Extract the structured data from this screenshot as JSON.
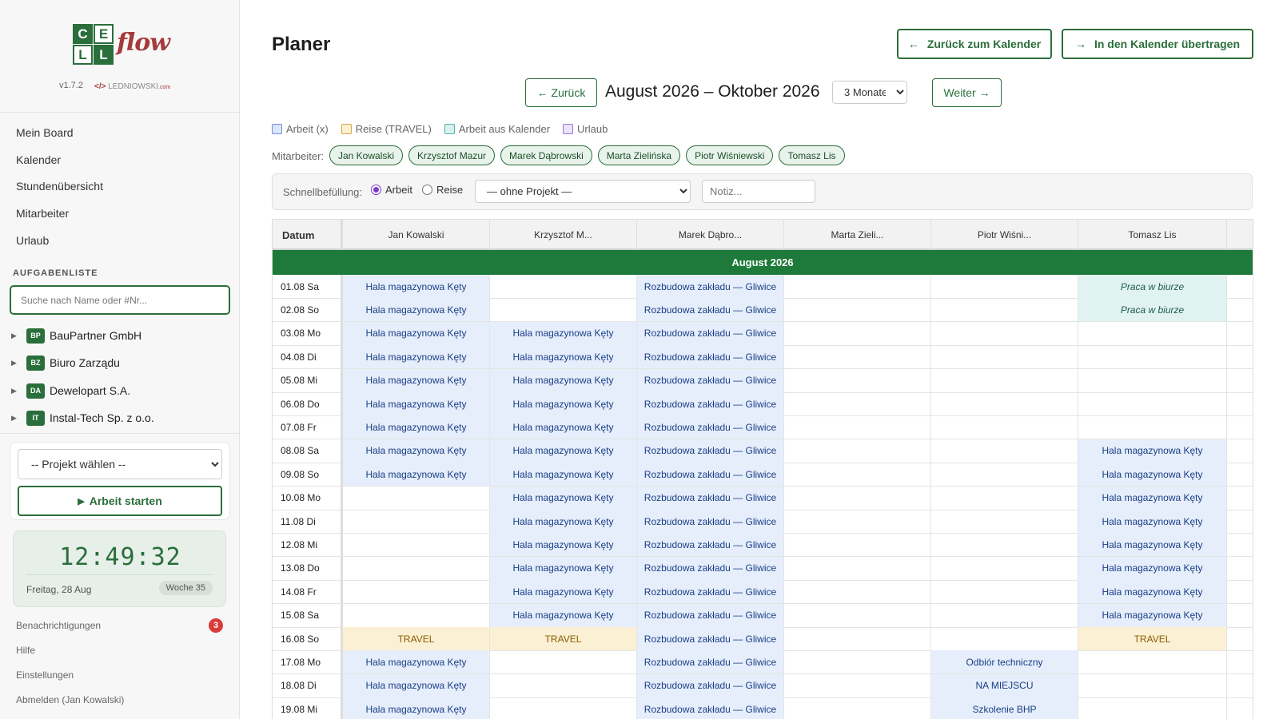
{
  "app": {
    "logo_letters": [
      "C",
      "E",
      "L",
      "L"
    ],
    "logo_word": "flow",
    "version": "v1.7.2",
    "brand_prefix": "</>",
    "brand_name": "LEDNIOWSKI",
    "brand_suffix": ".com"
  },
  "sidebar": {
    "nav": [
      "Mein Board",
      "Kalender",
      "Stundenübersicht",
      "Mitarbeiter",
      "Urlaub"
    ],
    "section_title": "AUFGABENLISTE",
    "search_placeholder": "Suche nach Name oder #Nr...",
    "tree": [
      {
        "abbr": "BP",
        "name": "BauPartner GmbH"
      },
      {
        "abbr": "BZ",
        "name": "Biuro Zarządu"
      },
      {
        "abbr": "DA",
        "name": "Dewelopart S.A."
      },
      {
        "abbr": "IT",
        "name": "Instal-Tech Sp. z o.o."
      }
    ],
    "project_select": "-- Projekt wählen --",
    "start_button": "Arbeit starten",
    "clock": {
      "time": "12:49:32",
      "date": "Freitag, 28 Aug",
      "week": "Woche 35"
    },
    "footer": {
      "notifications": "Benachrichtigungen",
      "notifications_count": "3",
      "help": "Hilfe",
      "settings": "Einstellungen",
      "logout": "Abmelden (Jan Kowalski)"
    }
  },
  "header": {
    "title": "Planer",
    "back_calendar": "Zurück zum Kalender",
    "transfer_calendar": "In den Kalender übertragen"
  },
  "period": {
    "prev": "← Zurück",
    "label": "August 2026 – Oktober 2026",
    "range": "3 Monate",
    "next": "Weiter →"
  },
  "legend": [
    {
      "label": "Arbeit (x)",
      "color": "#dbe6fb",
      "border": "#6f8fd6"
    },
    {
      "label": "Reise (TRAVEL)",
      "color": "#fbf0d3",
      "border": "#d9a93b"
    },
    {
      "label": "Arbeit aus Kalender",
      "color": "#d8f1ee",
      "border": "#4fb3a6"
    },
    {
      "label": "Urlaub",
      "color": "#ece3fb",
      "border": "#9a72d9"
    }
  ],
  "employees_label": "Mitarbeiter:",
  "employees": [
    "Jan Kowalski",
    "Krzysztof Mazur",
    "Marek Dąbrowski",
    "Marta Zielińska",
    "Piotr Wiśniewski",
    "Tomasz Lis"
  ],
  "quickfill": {
    "label": "Schnellbefüllung:",
    "opt_work": "Arbeit",
    "opt_travel": "Reise",
    "project": "— ohne Projekt —",
    "note_placeholder": "Notiz..."
  },
  "grid": {
    "date_header": "Datum",
    "columns": [
      "Jan Kowalski",
      "Krzysztof M...",
      "Marek Dąbro...",
      "Marta Zieli...",
      "Piotr Wiśni...",
      "Tomasz Lis"
    ],
    "month": "August 2026",
    "rows": [
      {
        "date": "01.08 Sa",
        "cells": [
          [
            "w",
            "Hala magazynowa Kęty"
          ],
          [
            "",
            ""
          ],
          [
            "w",
            "Rozbudowa zakładu — Gliwice"
          ],
          [
            "",
            ""
          ],
          [
            "",
            ""
          ],
          [
            "k",
            "Praca w biurze"
          ]
        ]
      },
      {
        "date": "02.08 So",
        "cells": [
          [
            "w",
            "Hala magazynowa Kęty"
          ],
          [
            "",
            ""
          ],
          [
            "w",
            "Rozbudowa zakładu — Gliwice"
          ],
          [
            "",
            ""
          ],
          [
            "",
            ""
          ],
          [
            "k",
            "Praca w biurze"
          ]
        ]
      },
      {
        "date": "03.08 Mo",
        "cells": [
          [
            "w",
            "Hala magazynowa Kęty"
          ],
          [
            "w",
            "Hala magazynowa Kęty"
          ],
          [
            "w",
            "Rozbudowa zakładu — Gliwice"
          ],
          [
            "",
            ""
          ],
          [
            "",
            ""
          ],
          [
            "",
            ""
          ]
        ]
      },
      {
        "date": "04.08 Di",
        "cells": [
          [
            "w",
            "Hala magazynowa Kęty"
          ],
          [
            "w",
            "Hala magazynowa Kęty"
          ],
          [
            "w",
            "Rozbudowa zakładu — Gliwice"
          ],
          [
            "",
            ""
          ],
          [
            "",
            ""
          ],
          [
            "",
            ""
          ]
        ]
      },
      {
        "date": "05.08 Mi",
        "cells": [
          [
            "w",
            "Hala magazynowa Kęty"
          ],
          [
            "w",
            "Hala magazynowa Kęty"
          ],
          [
            "w",
            "Rozbudowa zakładu — Gliwice"
          ],
          [
            "",
            ""
          ],
          [
            "",
            ""
          ],
          [
            "",
            ""
          ]
        ]
      },
      {
        "date": "06.08 Do",
        "cells": [
          [
            "w",
            "Hala magazynowa Kęty"
          ],
          [
            "w",
            "Hala magazynowa Kęty"
          ],
          [
            "w",
            "Rozbudowa zakładu — Gliwice"
          ],
          [
            "",
            ""
          ],
          [
            "",
            ""
          ],
          [
            "",
            ""
          ]
        ]
      },
      {
        "date": "07.08 Fr",
        "cells": [
          [
            "w",
            "Hala magazynowa Kęty"
          ],
          [
            "w",
            "Hala magazynowa Kęty"
          ],
          [
            "w",
            "Rozbudowa zakładu — Gliwice"
          ],
          [
            "",
            ""
          ],
          [
            "",
            ""
          ],
          [
            "",
            ""
          ]
        ]
      },
      {
        "date": "08.08 Sa",
        "cells": [
          [
            "w",
            "Hala magazynowa Kęty"
          ],
          [
            "w",
            "Hala magazynowa Kęty"
          ],
          [
            "w",
            "Rozbudowa zakładu — Gliwice"
          ],
          [
            "",
            ""
          ],
          [
            "",
            ""
          ],
          [
            "w",
            "Hala magazynowa Kęty"
          ]
        ]
      },
      {
        "date": "09.08 So",
        "cells": [
          [
            "w",
            "Hala magazynowa Kęty"
          ],
          [
            "w",
            "Hala magazynowa Kęty"
          ],
          [
            "w",
            "Rozbudowa zakładu — Gliwice"
          ],
          [
            "",
            ""
          ],
          [
            "",
            ""
          ],
          [
            "w",
            "Hala magazynowa Kęty"
          ]
        ]
      },
      {
        "date": "10.08 Mo",
        "cells": [
          [
            "",
            ""
          ],
          [
            "w",
            "Hala magazynowa Kęty"
          ],
          [
            "w",
            "Rozbudowa zakładu — Gliwice"
          ],
          [
            "",
            ""
          ],
          [
            "",
            ""
          ],
          [
            "w",
            "Hala magazynowa Kęty"
          ]
        ]
      },
      {
        "date": "11.08 Di",
        "cells": [
          [
            "",
            ""
          ],
          [
            "w",
            "Hala magazynowa Kęty"
          ],
          [
            "w",
            "Rozbudowa zakładu — Gliwice"
          ],
          [
            "",
            ""
          ],
          [
            "",
            ""
          ],
          [
            "w",
            "Hala magazynowa Kęty"
          ]
        ]
      },
      {
        "date": "12.08 Mi",
        "cells": [
          [
            "",
            ""
          ],
          [
            "w",
            "Hala magazynowa Kęty"
          ],
          [
            "w",
            "Rozbudowa zakładu — Gliwice"
          ],
          [
            "",
            ""
          ],
          [
            "",
            ""
          ],
          [
            "w",
            "Hala magazynowa Kęty"
          ]
        ]
      },
      {
        "date": "13.08 Do",
        "cells": [
          [
            "",
            ""
          ],
          [
            "w",
            "Hala magazynowa Kęty"
          ],
          [
            "w",
            "Rozbudowa zakładu — Gliwice"
          ],
          [
            "",
            ""
          ],
          [
            "",
            ""
          ],
          [
            "w",
            "Hala magazynowa Kęty"
          ]
        ]
      },
      {
        "date": "14.08 Fr",
        "cells": [
          [
            "",
            ""
          ],
          [
            "w",
            "Hala magazynowa Kęty"
          ],
          [
            "w",
            "Rozbudowa zakładu — Gliwice"
          ],
          [
            "",
            ""
          ],
          [
            "",
            ""
          ],
          [
            "w",
            "Hala magazynowa Kęty"
          ]
        ]
      },
      {
        "date": "15.08 Sa",
        "cells": [
          [
            "",
            ""
          ],
          [
            "w",
            "Hala magazynowa Kęty"
          ],
          [
            "w",
            "Rozbudowa zakładu — Gliwice"
          ],
          [
            "",
            ""
          ],
          [
            "",
            ""
          ],
          [
            "w",
            "Hala magazynowa Kęty"
          ]
        ]
      },
      {
        "date": "16.08 So",
        "cells": [
          [
            "t",
            "TRAVEL"
          ],
          [
            "t",
            "TRAVEL"
          ],
          [
            "w",
            "Rozbudowa zakładu — Gliwice"
          ],
          [
            "",
            ""
          ],
          [
            "",
            ""
          ],
          [
            "t",
            "TRAVEL"
          ]
        ]
      },
      {
        "date": "17.08 Mo",
        "cells": [
          [
            "w",
            "Hala magazynowa Kęty"
          ],
          [
            "",
            ""
          ],
          [
            "w",
            "Rozbudowa zakładu — Gliwice"
          ],
          [
            "",
            ""
          ],
          [
            "w",
            "Odbiór techniczny"
          ],
          [
            "",
            ""
          ]
        ]
      },
      {
        "date": "18.08 Di",
        "cells": [
          [
            "w",
            "Hala magazynowa Kęty"
          ],
          [
            "",
            ""
          ],
          [
            "w",
            "Rozbudowa zakładu — Gliwice"
          ],
          [
            "",
            ""
          ],
          [
            "w",
            "NA MIEJSCU"
          ],
          [
            "",
            ""
          ]
        ]
      },
      {
        "date": "19.08 Mi",
        "cells": [
          [
            "w",
            "Hala magazynowa Kęty"
          ],
          [
            "",
            ""
          ],
          [
            "w",
            "Rozbudowa zakładu — Gliwice"
          ],
          [
            "",
            ""
          ],
          [
            "w",
            "Szkolenie BHP"
          ],
          [
            "",
            ""
          ]
        ]
      }
    ]
  }
}
